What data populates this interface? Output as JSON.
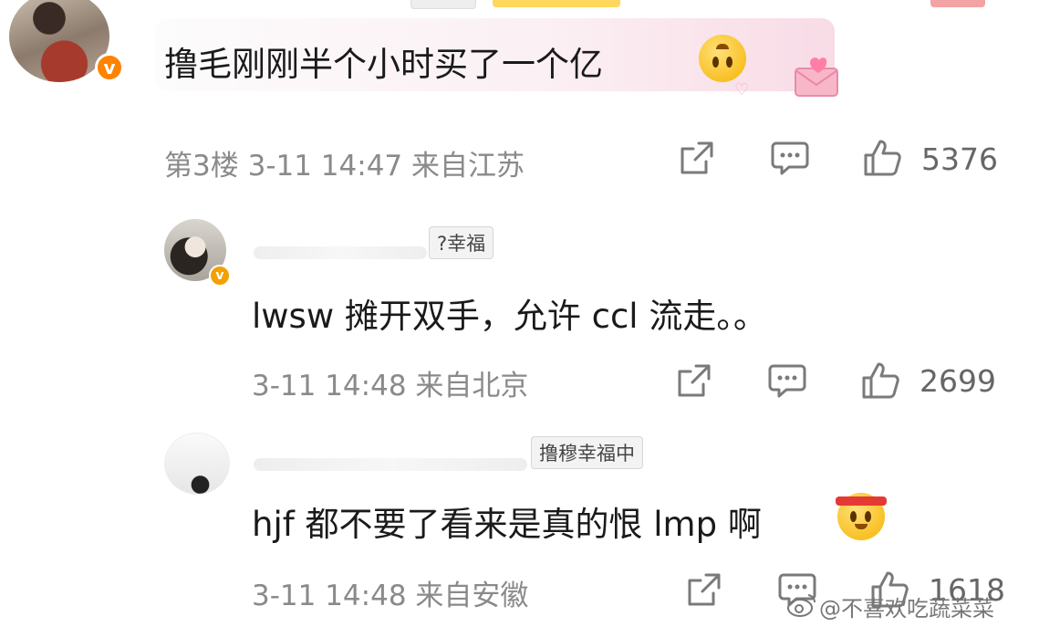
{
  "comments": [
    {
      "text": "撸毛刚刚半个小时买了一个亿",
      "floor": "第3楼",
      "time": "3-11 14:47",
      "location": "来自江苏",
      "likes": "5376",
      "emoji": "upside-down-face"
    },
    {
      "tag": "?幸福",
      "text": "lwsw 摊开双手，允许 ccl 流走。。",
      "time": "3-11 14:48",
      "location": "来自北京",
      "likes": "2699"
    },
    {
      "tag": "撸穆幸福中",
      "text": "hjf 都不要了看来是真的恨 lmp 啊",
      "time": "3-11 14:48",
      "location": "来自安徽",
      "likes": "1618",
      "emoji": "headband-face"
    }
  ],
  "badge_letter": "v",
  "watermark": "@不喜欢吃蔬菜菜",
  "colors": {
    "vip_orange": "#ff8200",
    "meta_gray": "#8a8a8a",
    "icon_gray": "#7a7a7a"
  },
  "icons": [
    "share-icon",
    "comment-icon",
    "thumbs-up-icon",
    "weibo-logo-icon"
  ]
}
